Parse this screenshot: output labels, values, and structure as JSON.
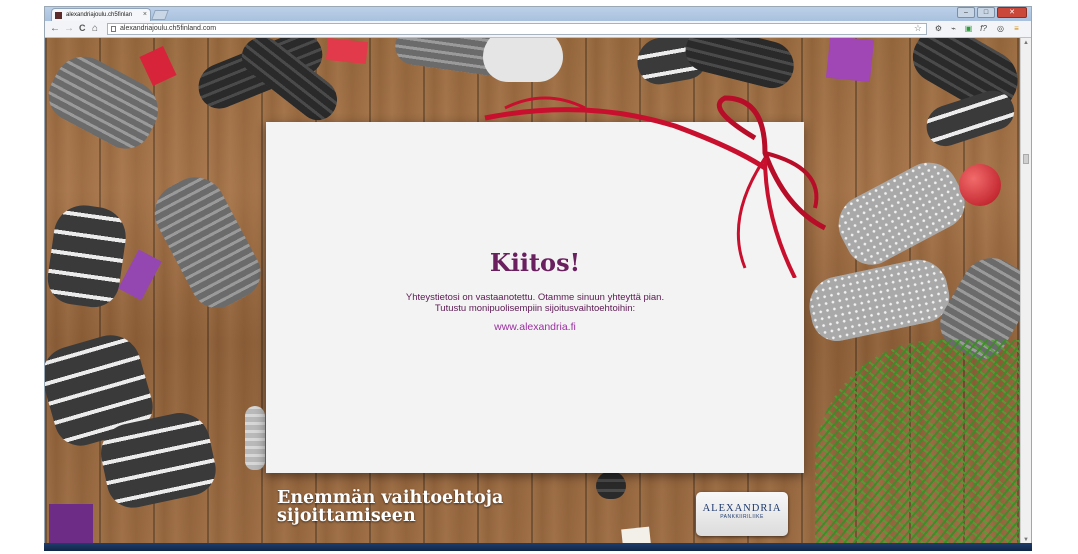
{
  "browser": {
    "tab_title": "alexandriajoulu.ch5finlan",
    "tab_close": "×",
    "url": "alexandriajoulu.ch5finland.com",
    "minimize": "–",
    "maximize": "□",
    "close": "✕",
    "back_icon": "←",
    "forward_icon": "→",
    "reload_icon": "C",
    "home_icon": "⌂",
    "star_icon": "☆",
    "ext_icons": [
      "⚙",
      "⌁",
      "▣",
      "f?",
      "◎",
      "≡"
    ]
  },
  "card": {
    "heading": "Kiitos!",
    "line1": "Yhteystietosi on vastaanotettu. Otamme sinuun yhteyttä pian.",
    "line2": "Tutustu monipuolisempiin sijoitusvaihtoehtoihin:",
    "link": "www.alexandria.fi"
  },
  "footer": {
    "tagline_line1": "Enemmän vaihtoehtoja",
    "tagline_line2": "sijoittamiseen",
    "logo_brand": "ALEXANDRIA",
    "logo_sub": "PANKKIIRILIIKE"
  },
  "colors": {
    "heading": "#6a1f5e",
    "link": "#9b2fa1",
    "ribbon": "#c8102e"
  }
}
